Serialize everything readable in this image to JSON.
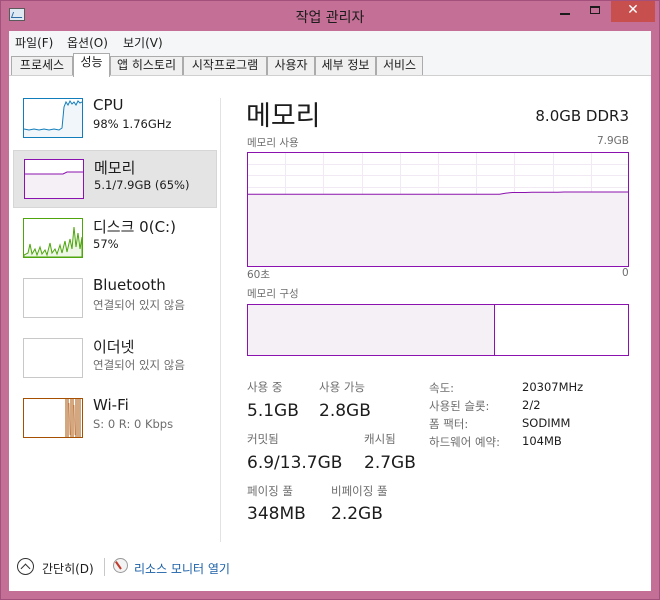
{
  "window": {
    "title": "작업 관리자",
    "close_glyph": "✕"
  },
  "menu": [
    {
      "label": "파일(F)"
    },
    {
      "label": "옵션(O)"
    },
    {
      "label": "보기(V)"
    }
  ],
  "tabs": [
    {
      "label": "프로세스"
    },
    {
      "label": "성능"
    },
    {
      "label": "앱 히스토리"
    },
    {
      "label": "시작프로그램"
    },
    {
      "label": "사용자"
    },
    {
      "label": "세부 정보"
    },
    {
      "label": "서비스"
    }
  ],
  "sidebar": {
    "cpu": {
      "title": "CPU",
      "subtitle": "98% 1.76GHz"
    },
    "memory": {
      "title": "메모리",
      "subtitle": "5.1/7.9GB (65%)"
    },
    "disk": {
      "title": "디스크 0(C:)",
      "subtitle": "57%"
    },
    "bluetooth": {
      "title": "Bluetooth",
      "subtitle": "연결되어 있지 않음"
    },
    "ethernet": {
      "title": "이더넷",
      "subtitle": "연결되어 있지 않음"
    },
    "wifi": {
      "title": "Wi-Fi",
      "subtitle": "S: 0 R: 0 Kbps"
    }
  },
  "main": {
    "title": "메모리",
    "spec": "8.0GB DDR3",
    "usage_graph": {
      "label": "메모리 사용",
      "max_label": "7.9GB",
      "x_start_label": "60초",
      "x_end_label": "0",
      "series_gb": [
        5.0,
        5.0,
        5.0,
        5.0,
        5.0,
        5.0,
        5.0,
        5.0,
        5.0,
        5.0,
        5.0,
        5.0,
        5.0,
        5.0,
        5.0,
        5.0,
        5.0,
        5.0,
        5.0,
        5.0,
        5.0,
        5.0,
        5.0,
        5.0,
        5.0,
        5.0,
        5.0,
        5.0,
        5.0,
        5.0,
        5.0,
        5.0,
        5.0,
        5.0,
        5.0,
        5.0,
        5.0,
        5.0,
        5.0,
        5.0,
        5.08,
        5.12,
        5.12,
        5.12,
        5.13,
        5.13,
        5.14,
        5.14,
        5.14,
        5.15,
        5.15,
        5.15,
        5.15,
        5.15,
        5.15,
        5.15,
        5.15,
        5.15,
        5.15,
        5.15
      ]
    },
    "composition": {
      "label": "메모리 구성",
      "in_use_fraction": 0.65
    },
    "stats": {
      "in_use_label": "사용 중",
      "in_use": "5.1GB",
      "available_label": "사용 가능",
      "available": "2.8GB",
      "committed_label": "커밋됨",
      "committed": "6.9/13.7GB",
      "cached_label": "캐시됨",
      "cached": "2.7GB",
      "paged_label": "페이징 풀",
      "paged": "348MB",
      "nonpaged_label": "비페이징 풀",
      "nonpaged": "2.2GB"
    },
    "details": [
      {
        "label": "속도:",
        "value": "20307MHz"
      },
      {
        "label": "사용된 슬롯:",
        "value": "2/2"
      },
      {
        "label": "폼 팩터:",
        "value": "SODIMM"
      },
      {
        "label": "하드웨어 예약:",
        "value": "104MB"
      }
    ]
  },
  "footer": {
    "fewer_details": "간단히(D)",
    "resource_monitor": "리소스 모니터 열기"
  },
  "colors": {
    "window_frame": "#c46f95",
    "memory_accent": "#8b12ae",
    "memory_fill": "#f4f0f5",
    "cpu_accent": "#117dbb",
    "disk_accent": "#4da60c",
    "wifi_accent": "#a74f01",
    "link": "#1a5fa8",
    "close_button": "#c7504e"
  },
  "icons": {
    "app": "task-manager-icon",
    "minimize": "minimize-icon",
    "maximize": "maximize-icon",
    "close": "close-icon",
    "fewer_details": "chevron-up-circle-icon",
    "resource_monitor": "resource-monitor-icon"
  }
}
